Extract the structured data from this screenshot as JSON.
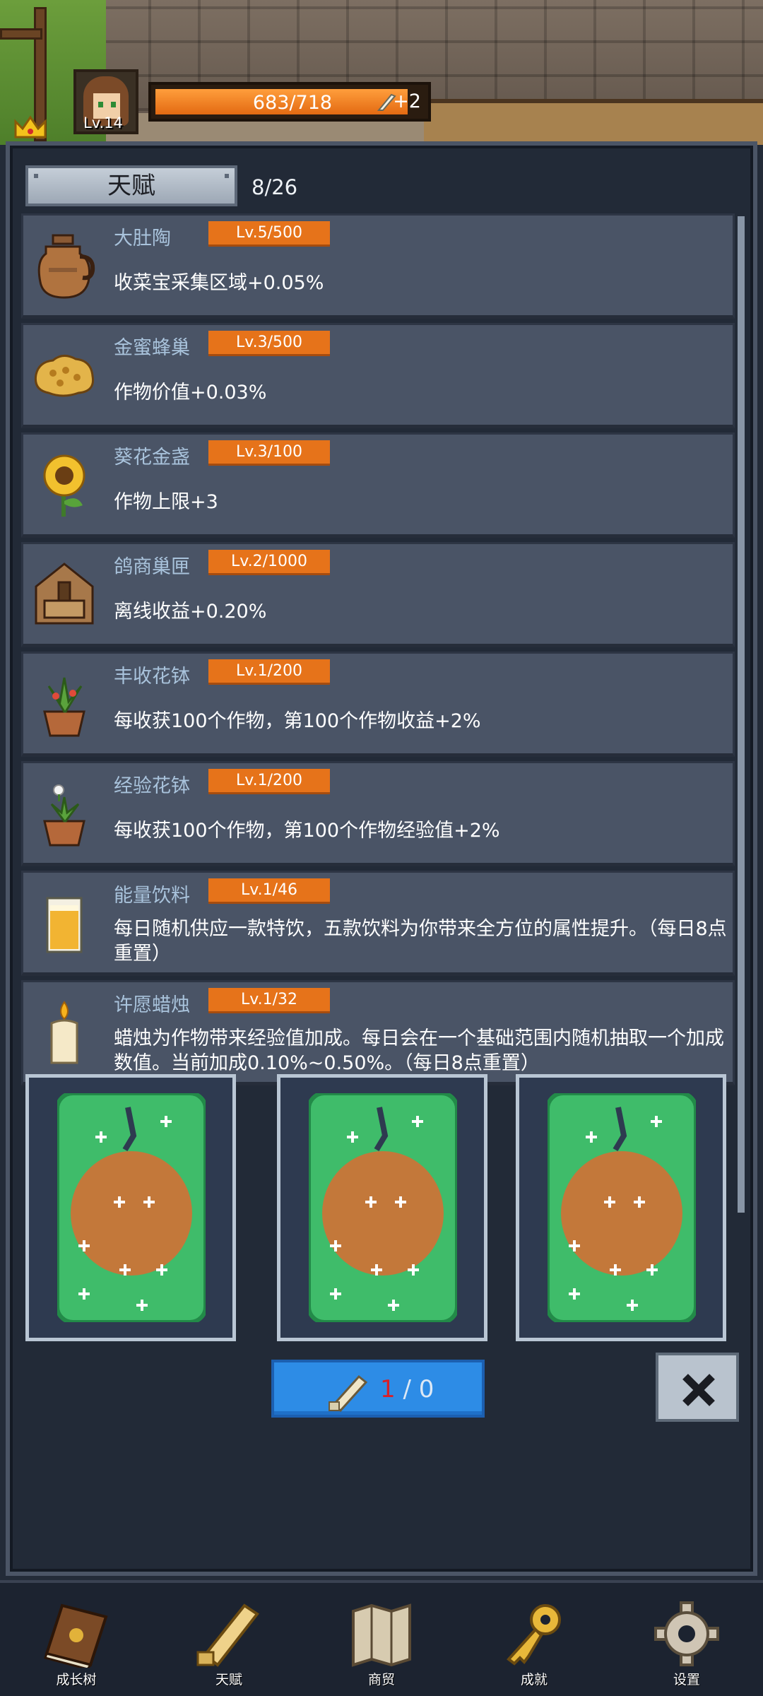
{
  "player": {
    "level": "Lv.14",
    "xp": "683/718",
    "xp_fraction": 0.95,
    "bonus": "+2"
  },
  "panel": {
    "tab": "天赋",
    "count": "8/26"
  },
  "talents": [
    {
      "name": "大肚陶",
      "level": "Lv.5/500",
      "desc": "收菜宝采集区域+0.05%",
      "icon": "jug-icon"
    },
    {
      "name": "金蜜蜂巢",
      "level": "Lv.3/500",
      "desc": "作物价值+0.03%",
      "icon": "honeycomb-icon"
    },
    {
      "name": "葵花金盏",
      "level": "Lv.3/100",
      "desc": "作物上限+3",
      "icon": "sunflower-icon"
    },
    {
      "name": "鸽商巢匣",
      "level": "Lv.2/1000",
      "desc": "离线收益+0.20%",
      "icon": "birdhouse-icon"
    },
    {
      "name": "丰收花钵",
      "level": "Lv.1/200",
      "desc": "每收获100个作物，第100个作物收益+2%",
      "icon": "flower-pot-icon"
    },
    {
      "name": "经验花钵",
      "level": "Lv.1/200",
      "desc": "每收获100个作物，第100个作物经验值+2%",
      "icon": "flower-pot-icon"
    },
    {
      "name": "能量饮料",
      "level": "Lv.1/46",
      "desc": "每日随机供应一款特饮，五款饮料为你带来全方位的属性提升。（每日8点重置）",
      "icon": "drink-icon"
    },
    {
      "name": "许愿蜡烛",
      "level": "Lv.1/32",
      "desc": "蜡烛为作物带来经验值加成。每日会在一个基础范围内随机抽取一个加成数值。当前加成0.10%~0.50%。（每日8点重置）",
      "icon": "candle-icon"
    }
  ],
  "draw": {
    "current": "1",
    "separator": " / ",
    "total": "0"
  },
  "nav": [
    {
      "label": "成长树",
      "icon": "book-icon"
    },
    {
      "label": "天赋",
      "icon": "scroll-icon"
    },
    {
      "label": "商贸",
      "icon": "map-icon"
    },
    {
      "label": "成就",
      "icon": "key-icon"
    },
    {
      "label": "设置",
      "icon": "gear-icon"
    }
  ]
}
